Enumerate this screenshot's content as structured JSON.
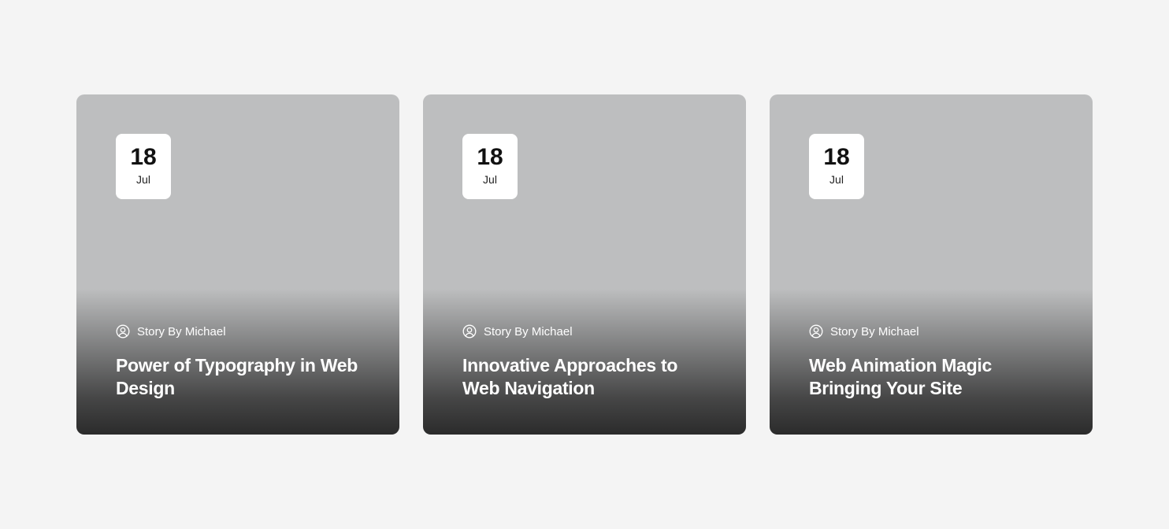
{
  "cards": [
    {
      "date_day": "18",
      "date_month": "Jul",
      "author_icon": "user-circle-icon",
      "author_label": "Story By Michael",
      "title": "Power of Typography in Web Design"
    },
    {
      "date_day": "18",
      "date_month": "Jul",
      "author_icon": "user-circle-icon",
      "author_label": "Story By Michael",
      "title": "Innovative Approaches to Web Navigation"
    },
    {
      "date_day": "18",
      "date_month": "Jul",
      "author_icon": "user-circle-icon",
      "author_label": "Story By Michael",
      "title": "Web Animation Magic Bringing Your Site"
    }
  ],
  "colors": {
    "page_background": "#f4f4f4",
    "card_background": "#bdbebf",
    "badge_background": "#ffffff",
    "text_light": "#ffffff",
    "text_dark": "#111111"
  }
}
